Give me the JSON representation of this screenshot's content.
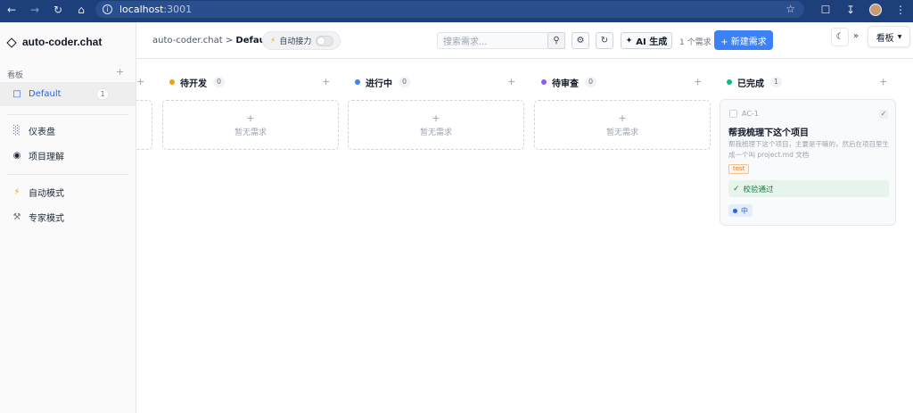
{
  "browser": {
    "url_host": "localhost",
    "url_port": ":3001"
  },
  "sidebar": {
    "brand": "auto-coder.chat",
    "section_label": "看板",
    "section_add": "+",
    "boards": [
      {
        "label": "Default",
        "count": "1",
        "active": true
      }
    ],
    "nav": [
      {
        "label": "仪表盘",
        "icon": "bar-chart-icon"
      },
      {
        "label": "项目理解",
        "icon": "target-icon"
      }
    ],
    "modes": [
      {
        "label": "自动模式",
        "icon": "lightning-icon"
      },
      {
        "label": "专家模式",
        "icon": "wrench-icon"
      }
    ]
  },
  "header": {
    "breadcrumb_root": "auto-coder.chat",
    "breadcrumb_sep": " > ",
    "breadcrumb_current": "Default",
    "relay_label": "自动接力",
    "search_placeholder": "搜索需求...",
    "ai_label": "AI 生成",
    "req_count": "1 个需求",
    "new_label": "+ 新建需求",
    "expand_glyph": "»",
    "view_label": "看板"
  },
  "board": {
    "empty_text": "暂无需求",
    "add_glyph": "+",
    "columns": [
      {
        "label": "待开发",
        "count": "0",
        "color": "#f59e0b"
      },
      {
        "label": "进行中",
        "count": "0",
        "color": "#3b82f6"
      },
      {
        "label": "待审查",
        "count": "0",
        "color": "#8b5cf6"
      },
      {
        "label": "已完成",
        "count": "1",
        "color": "#10b981"
      }
    ],
    "card": {
      "id": "AC-1",
      "title": "帮我梳理下这个项目",
      "desc": "帮我梳理下这个项目，主要是干嘛的，然后在项目里生成一个叫 project.md 文档",
      "tag": "test",
      "verify": "校验通过",
      "priority": "中"
    }
  }
}
